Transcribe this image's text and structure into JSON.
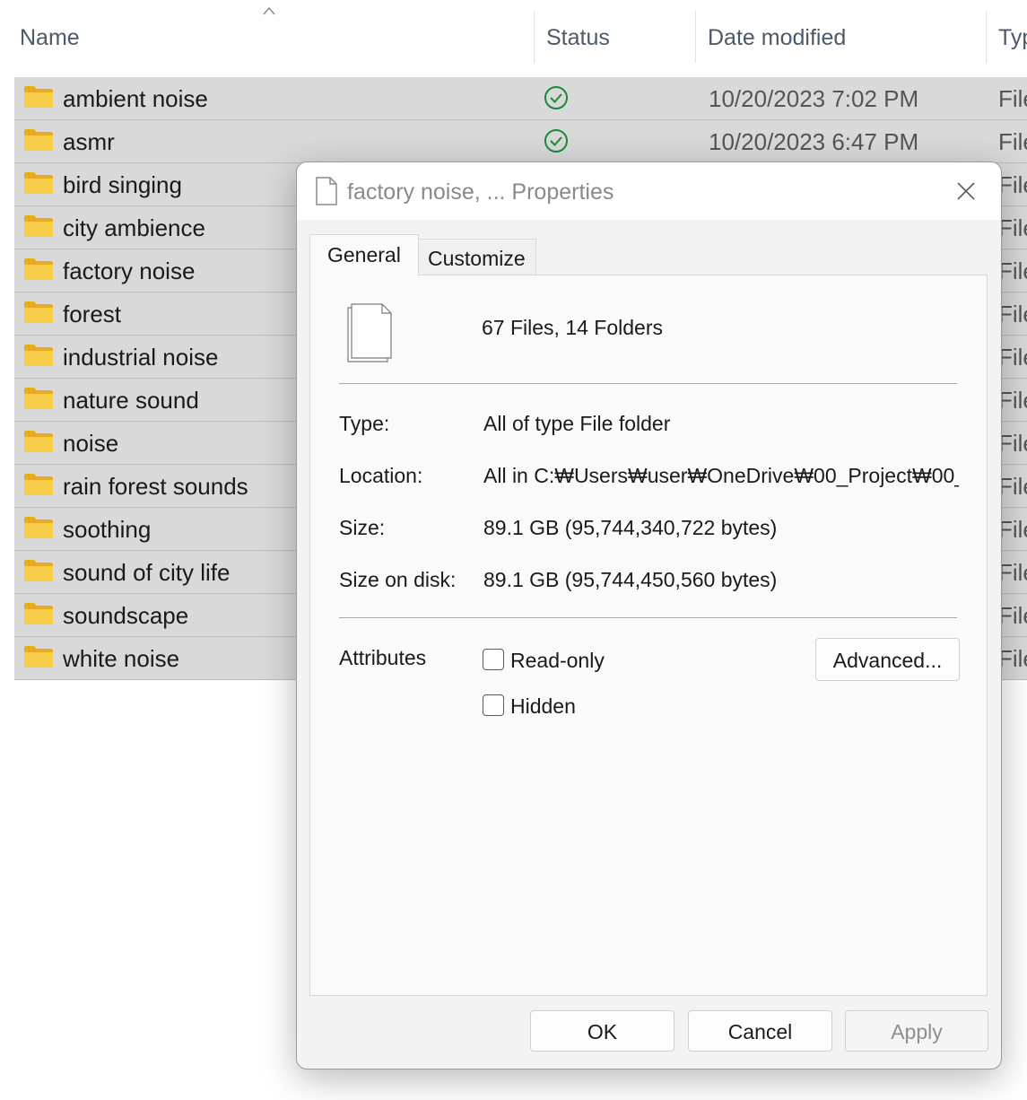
{
  "explorer": {
    "columns": {
      "name": "Name",
      "status": "Status",
      "date_modified": "Date modified",
      "type": "Typ"
    },
    "rows": [
      {
        "name": "ambient noise",
        "status": "synced",
        "date": "10/20/2023 7:02 PM",
        "type": "File"
      },
      {
        "name": "asmr",
        "status": "synced",
        "date": "10/20/2023 6:47 PM",
        "type": "File"
      },
      {
        "name": "bird singing",
        "status": "",
        "date": "",
        "type": "File"
      },
      {
        "name": "city ambience",
        "status": "",
        "date": "",
        "type": "File"
      },
      {
        "name": "factory noise",
        "status": "",
        "date": "",
        "type": "File"
      },
      {
        "name": "forest",
        "status": "",
        "date": "",
        "type": "File"
      },
      {
        "name": "industrial noise",
        "status": "",
        "date": "",
        "type": "File"
      },
      {
        "name": "nature sound",
        "status": "",
        "date": "",
        "type": "File"
      },
      {
        "name": "noise",
        "status": "",
        "date": "",
        "type": "File"
      },
      {
        "name": "rain forest sounds",
        "status": "",
        "date": "",
        "type": "File"
      },
      {
        "name": "soothing",
        "status": "",
        "date": "",
        "type": "File"
      },
      {
        "name": "sound of city life",
        "status": "",
        "date": "",
        "type": "File"
      },
      {
        "name": "soundscape",
        "status": "",
        "date": "",
        "type": "File"
      },
      {
        "name": "white noise",
        "status": "",
        "date": "",
        "type": "File"
      }
    ],
    "icons": {
      "folder": "folder-icon",
      "status_ok": "sync-check-icon",
      "sort": "sort-ascending-icon"
    },
    "colors": {
      "selection": "#d9d9d9",
      "folder": "#f6c63e",
      "status_ok": "#1a8a3a"
    }
  },
  "dialog": {
    "title": "factory noise, ... Properties",
    "tabs": [
      {
        "label": "General",
        "active": true
      },
      {
        "label": "Customize",
        "active": false
      }
    ],
    "summary": "67 Files, 14 Folders",
    "properties": [
      {
        "label": "Type:",
        "value": "All of type File folder"
      },
      {
        "label": "Location:",
        "value": "All in C:₩Users₩user₩OneDrive₩00_Project₩00_"
      },
      {
        "label": "Size:",
        "value": "89.1 GB (95,744,340,722 bytes)"
      },
      {
        "label": "Size on disk:",
        "value": "89.1 GB (95,744,450,560 bytes)"
      }
    ],
    "attributes": {
      "label": "Attributes",
      "read_only": {
        "label": "Read-only",
        "checked": false
      },
      "hidden": {
        "label": "Hidden",
        "checked": false
      },
      "advanced_label": "Advanced..."
    },
    "buttons": {
      "ok": "OK",
      "cancel": "Cancel",
      "apply": "Apply",
      "apply_enabled": false
    },
    "icons": {
      "title": "document-icon",
      "summary": "multiple-files-icon",
      "close": "close-icon"
    }
  }
}
